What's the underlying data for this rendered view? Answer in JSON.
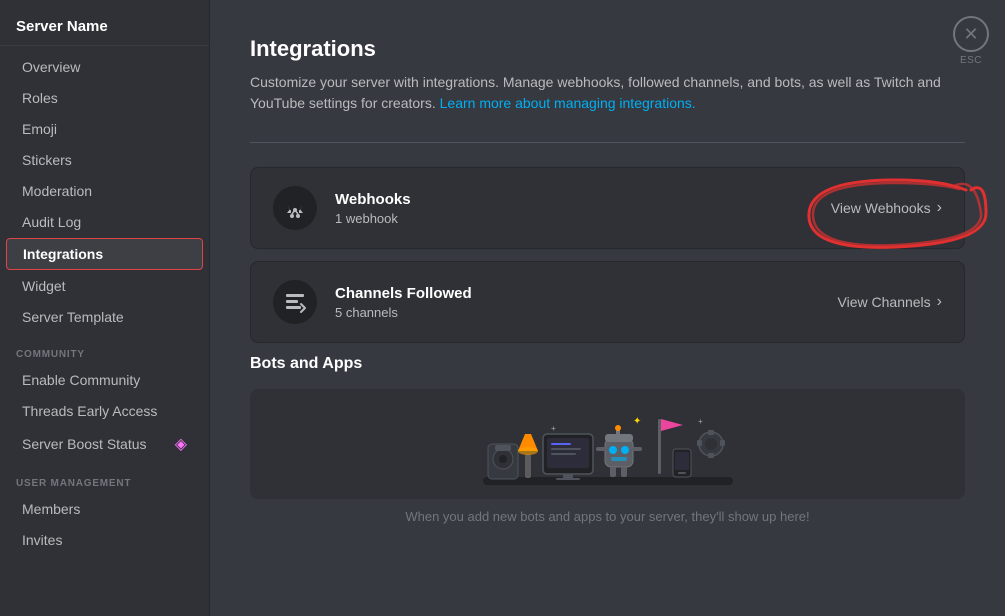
{
  "server": {
    "name": "Server Name"
  },
  "sidebar": {
    "items": [
      {
        "label": "Overview",
        "id": "overview",
        "active": false
      },
      {
        "label": "Roles",
        "id": "roles",
        "active": false
      },
      {
        "label": "Emoji",
        "id": "emoji",
        "active": false
      },
      {
        "label": "Stickers",
        "id": "stickers",
        "active": false
      },
      {
        "label": "Moderation",
        "id": "moderation",
        "active": false
      },
      {
        "label": "Audit Log",
        "id": "audit-log",
        "active": false
      },
      {
        "label": "Integrations",
        "id": "integrations",
        "active": true
      },
      {
        "label": "Widget",
        "id": "widget",
        "active": false
      },
      {
        "label": "Server Template",
        "id": "server-template",
        "active": false
      }
    ],
    "community_section": "COMMUNITY",
    "community_items": [
      {
        "label": "Enable Community",
        "id": "enable-community"
      },
      {
        "label": "Threads Early Access",
        "id": "threads-early-access"
      }
    ],
    "boost_item": "Server Boost Status",
    "user_management_section": "USER MANAGEMENT",
    "user_management_items": [
      {
        "label": "Members",
        "id": "members"
      },
      {
        "label": "Invites",
        "id": "invites"
      }
    ]
  },
  "main": {
    "title": "Integrations",
    "description_part1": "Customize your server with integrations. Manage webhooks, followed channels, and bots, as well as Twitch and YouTube settings for creators.",
    "description_link_text": "Learn more about managing integrations.",
    "webhooks_card": {
      "title": "Webhooks",
      "subtitle": "1 webhook",
      "action_label": "View Webhooks"
    },
    "channels_card": {
      "title": "Channels Followed",
      "subtitle": "5 channels",
      "action_label": "View Channels"
    },
    "bots_section_title": "Bots and Apps",
    "bots_empty_text": "When you add new bots and apps to your server, they'll show up here!"
  },
  "close_button": {
    "label": "ESC"
  }
}
